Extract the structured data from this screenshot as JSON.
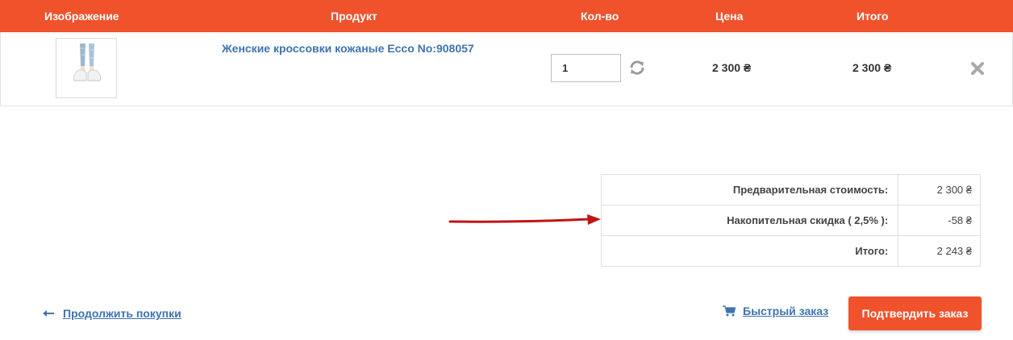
{
  "colors": {
    "accent": "#f0522c",
    "link": "#3f73b0",
    "arrow": "#c01414"
  },
  "header": {
    "image": "Изображение",
    "product": "Продукт",
    "qty": "Кол-во",
    "price": "Цена",
    "total": "Итого"
  },
  "item": {
    "name": "Женские кроссовки кожаные Ecco No:908057",
    "qty": "1",
    "price": "2 300 ₴",
    "total": "2 300 ₴",
    "refresh_icon": "refresh-icon",
    "remove_icon": "close-icon"
  },
  "totals": {
    "subtotal_label": "Предварительная стоимость:",
    "subtotal_value": "2 300 ₴",
    "discount_label": "Накопительная скидка ( 2,5% ):",
    "discount_value": "-58 ₴",
    "total_label": "Итого:",
    "total_value": "2 243 ₴"
  },
  "actions": {
    "continue_label": "Продолжить покупки",
    "quick_order_label": "Быстрый заказ",
    "confirm_label": "Подтвердить заказ"
  }
}
